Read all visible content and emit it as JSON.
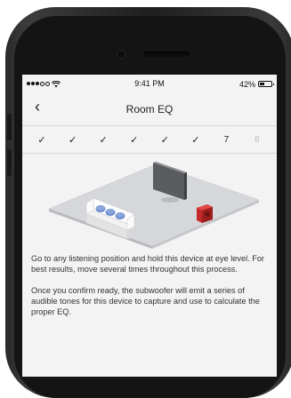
{
  "status": {
    "signal_dots": 5,
    "signal_filled": 3,
    "time": "9:41 PM",
    "battery": "42%",
    "battery_level": 0.42
  },
  "nav": {
    "title": "Room EQ",
    "back_icon": "chevron-left-icon"
  },
  "steps": [
    "✓",
    "✓",
    "✓",
    "✓",
    "✓",
    "✓",
    "7",
    "8"
  ],
  "current_step": 7,
  "body": {
    "paragraph1": "Go to any listening position and hold this device at eye level. For best results, move several times throughout this process.",
    "paragraph2": "Once you confirm ready, the subwoofer will emit a series of audible tones for this device to capture and use to calculate the proper EQ."
  },
  "colors": {
    "floor": "#d5d7da",
    "sofa": "#ededed",
    "cushion": "#6f8fcf",
    "tv": "#5a5c60",
    "subwoofer": "#c42a2a"
  }
}
